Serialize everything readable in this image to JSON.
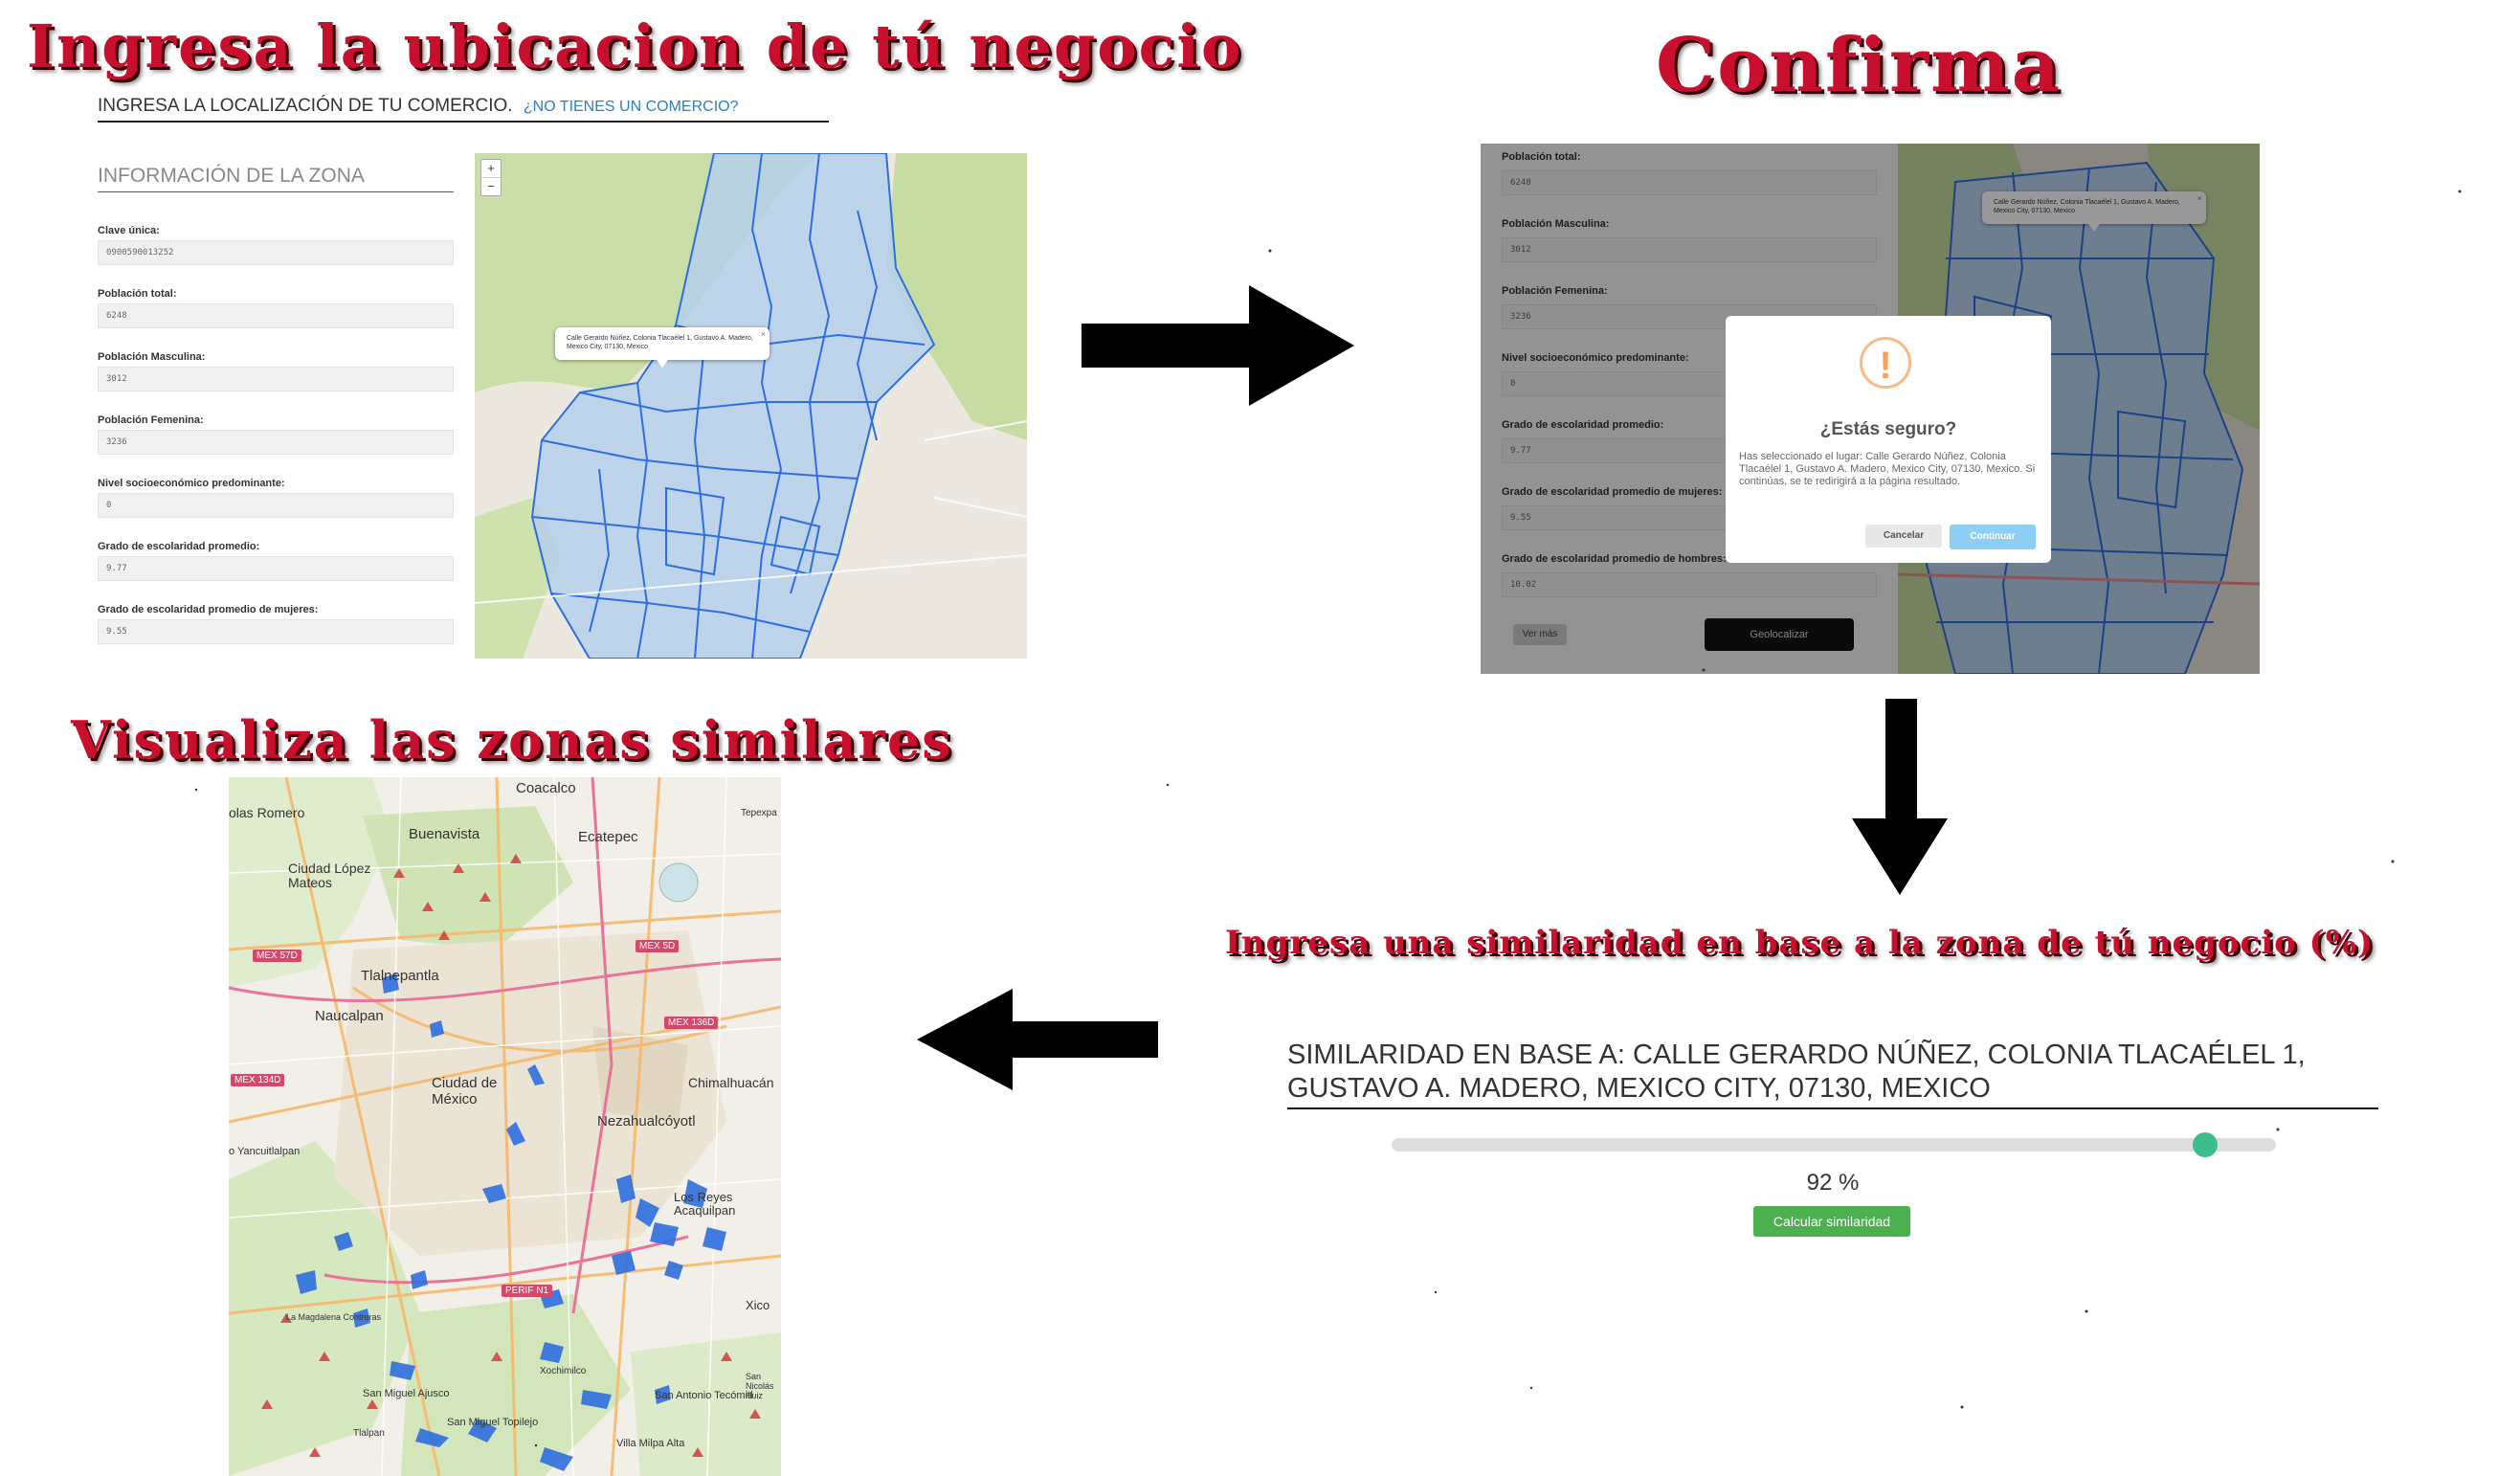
{
  "titles": {
    "step1": "Ingresa la ubicacion de tú negocio",
    "step2": "Confirma",
    "step3": "Ingresa una similaridad en base a la zona de tú negocio (%)",
    "step4": "Visualiza las zonas similares"
  },
  "panel1": {
    "heading": "INGRESA LA LOCALIZACIÓN DE TU COMERCIO.",
    "heading_link": "¿NO TIENES UN COMERCIO?",
    "info_title": "INFORMACIÓN DE LA ZONA",
    "fields": [
      {
        "label": "Clave única:",
        "value": "0900590013252"
      },
      {
        "label": "Población total:",
        "value": "6248"
      },
      {
        "label": "Población Masculina:",
        "value": "3012"
      },
      {
        "label": "Población Femenina:",
        "value": "3236"
      },
      {
        "label": "Nivel socioeconómico predominante:",
        "value": "0"
      },
      {
        "label": "Grado de escolaridad promedio:",
        "value": "9.77"
      },
      {
        "label": "Grado de escolaridad promedio de mujeres:",
        "value": "9.55"
      }
    ],
    "zoom_in": "+",
    "zoom_out": "−",
    "popup_text": "Calle Gerardo Núñez, Colonia Tlacaélel 1, Gustavo A. Madero, Mexico City, 07130, Mexico",
    "popup_close": "×"
  },
  "panel2": {
    "fields": [
      {
        "label": "Población total:",
        "value": "6248"
      },
      {
        "label": "Población Masculina:",
        "value": "3012"
      },
      {
        "label": "Población Femenina:",
        "value": "3236"
      },
      {
        "label": "Nivel socioeconómico predominante:",
        "value": "0"
      },
      {
        "label": "Grado de escolaridad promedio:",
        "value": "9.77"
      },
      {
        "label": "Grado de escolaridad promedio de mujeres:",
        "value": "9.55"
      },
      {
        "label": "Grado de escolaridad promedio de hombres:",
        "value": "10.02"
      }
    ],
    "popup_text": "Calle Gerardo Núñez, Colonia Tlacaélel 1, Gustavo A. Madero, Mexico City, 07130, Mexico",
    "popup_close": "×",
    "modal": {
      "icon": "!",
      "title": "¿Estás seguro?",
      "text": "Has seleccionado el lugar: Calle Gerardo Núñez, Colonia Tlacaélel 1, Gustavo A. Madero, Mexico City, 07130, Mexico. Si continúas, se te redirigirá a la página resultado.",
      "cancel": "Cancelar",
      "continue": "Continuar"
    },
    "more_button": "Ver más",
    "geo_button": "Geolocalizar"
  },
  "panel3": {
    "title": "SIMILARIDAD EN BASE A: CALLE GERARDO NÚÑEZ, COLONIA TLACAÉLEL 1, GUSTAVO A. MADERO, MEXICO CITY, 07130, MEXICO",
    "slider_value": 92,
    "percent_label": "92 %",
    "button": "Calcular similaridad"
  },
  "panel4": {
    "labels": [
      "Coacalco",
      "Tepexpa",
      "olas Romero",
      "Buenavista",
      "Ecatepec",
      "Ciudad López Mateos",
      "Tlalnepantla",
      "Naucalpan",
      "Ciudad de México",
      "Chimalhuacán",
      "Nezahualcóyotl",
      "o Yancuitlalpan",
      "Los Reyes Acaquilpan",
      "Xico",
      "Xochimilco",
      "San Miguel Ajusco",
      "San Antonio Tecómitl",
      "San Miguel Topilejo",
      "Villa Milpa Alta",
      "La Magdalena Contreras",
      "Tlalpan",
      "San Nicolás Huiz"
    ],
    "road_signs": [
      "MEX 57D",
      "MEX 5D",
      "MEX 136D",
      "MEX 134D",
      "PERIF N1"
    ]
  },
  "colors": {
    "title_red": "#c8102e",
    "slider_green": "#3cbd8c",
    "button_green": "#4caf50",
    "link_blue": "#2d7fc5",
    "zone_blue": "#2e6fe0"
  }
}
